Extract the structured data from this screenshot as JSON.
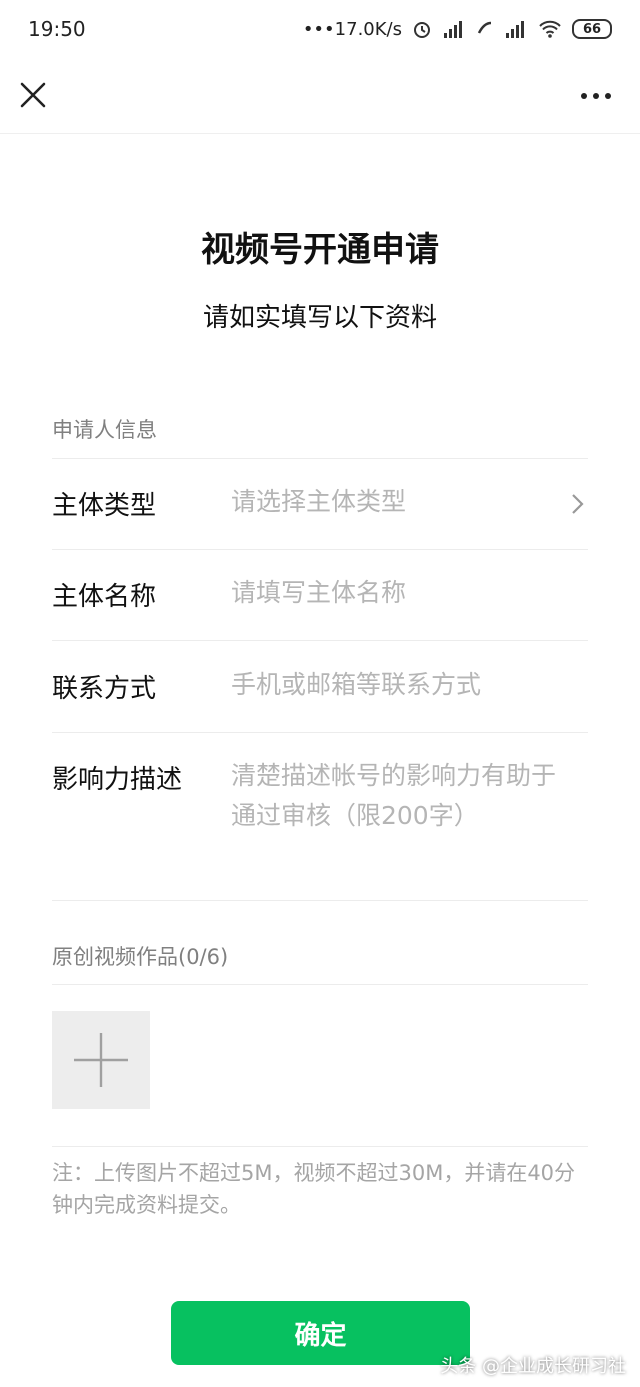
{
  "status_bar": {
    "time": "19:50",
    "network_speed": "•••17.0K/s",
    "battery": "66",
    "icons": [
      "alarm-icon",
      "hd-signal-icon",
      "call-icon",
      "signal-icon",
      "wifi-icon",
      "battery-icon"
    ]
  },
  "nav": {
    "close_icon": "close-icon",
    "more_icon": "more-icon"
  },
  "header": {
    "title": "视频号开通申请",
    "subtitle": "请如实填写以下资料"
  },
  "applicant_section": {
    "label": "申请人信息",
    "fields": [
      {
        "label": "主体类型",
        "placeholder": "请选择主体类型",
        "has_chevron": true
      },
      {
        "label": "主体名称",
        "placeholder": "请填写主体名称"
      },
      {
        "label": "联系方式",
        "placeholder": "手机或邮箱等联系方式"
      },
      {
        "label": "影响力描述",
        "placeholder": "清楚描述帐号的影响力有助于通过审核（限200字）"
      }
    ]
  },
  "works_section": {
    "label": "原创视频作品(0/6)",
    "upload_icon": "plus-icon"
  },
  "note": "注：上传图片不超过5M，视频不超过30M，并请在40分钟内完成资料提交。",
  "confirm_label": "确定",
  "watermark": "头条 @企业成长研习社",
  "colors": {
    "primary_green": "#07c160",
    "placeholder_gray": "#b5b5b5",
    "label_gray": "#808080"
  }
}
